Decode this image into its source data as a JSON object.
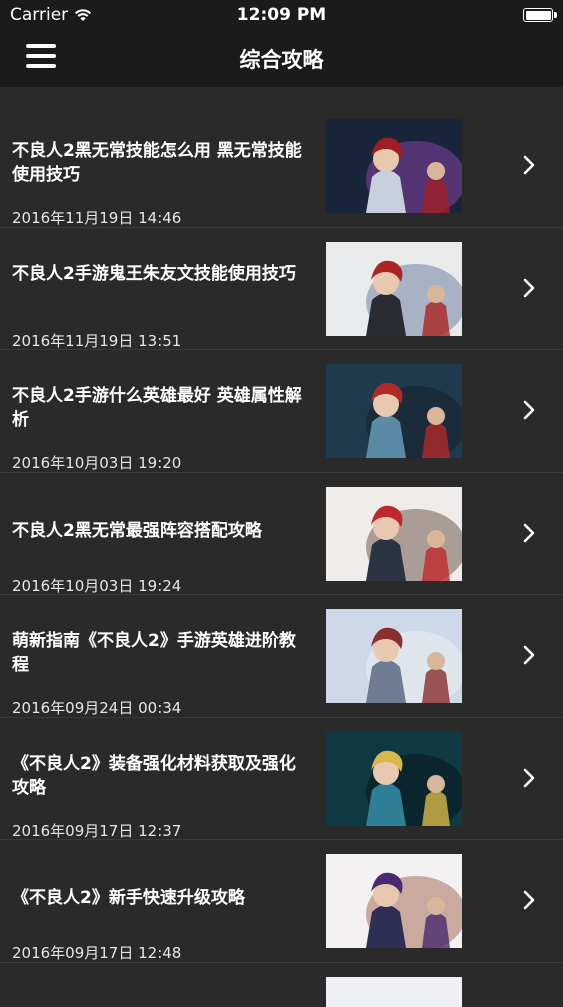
{
  "status_bar": {
    "carrier": "Carrier",
    "time": "12:09 PM"
  },
  "nav": {
    "title": "综合攻略",
    "menu_icon": "hamburger-menu-icon"
  },
  "articles": [
    {
      "title": "不良人2黑无常技能怎么用 黑无常技能使用技巧",
      "date": "2016年11月19日 14:46",
      "thumb_palette": [
        "#18253a",
        "#a01f24",
        "#c7cfdc",
        "#6e3b8a"
      ]
    },
    {
      "title": "不良人2手游鬼王朱友文技能使用技巧",
      "date": "2016年11月19日 13:51",
      "thumb_palette": [
        "#e9eaec",
        "#aa2424",
        "#2b2b33",
        "#8a9bb3"
      ]
    },
    {
      "title": "不良人2手游什么英雄最好 英雄属性解析",
      "date": "2016年10月03日 19:20",
      "thumb_palette": [
        "#1f3a4c",
        "#b02a2a",
        "#5a8aa6",
        "#182633"
      ]
    },
    {
      "title": "不良人2黑无常最强阵容搭配攻略",
      "date": "2016年10月03日 19:24",
      "thumb_palette": [
        "#f0ecea",
        "#c0292b",
        "#2a3442",
        "#8c7c70"
      ]
    },
    {
      "title": "萌新指南《不良人2》手游英雄进阶教程",
      "date": "2016年09月24日 00:34",
      "thumb_palette": [
        "#cdd9e8",
        "#8a2e2e",
        "#6e7c94",
        "#e6e9f0"
      ]
    },
    {
      "title": "《不良人2》装备强化材料获取及强化攻略",
      "date": "2016年09月17日 12:37",
      "thumb_palette": [
        "#0f3a44",
        "#d8b84a",
        "#2e7f95",
        "#0a1c24"
      ]
    },
    {
      "title": "《不良人2》新手快速升级攻略",
      "date": "2016年09月17日 12:48",
      "thumb_palette": [
        "#f4f1f2",
        "#4a2a6e",
        "#2f2f55",
        "#b88b7a"
      ]
    }
  ]
}
